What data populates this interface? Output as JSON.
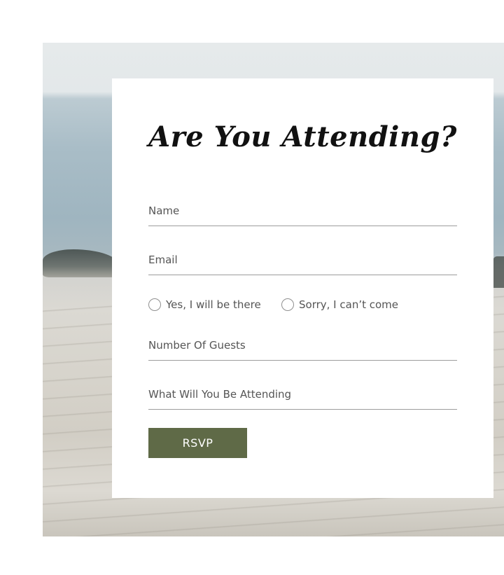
{
  "form": {
    "title": "Are You Attending?",
    "fields": {
      "name_placeholder": "Name",
      "email_placeholder": "Email",
      "guests_placeholder": "Number Of Guests",
      "attending_placeholder": "What Will You Be Attending"
    },
    "radio": {
      "yes_label": "Yes, I will be there",
      "no_label": "Sorry, I can’t come"
    },
    "submit_label": "RSVP"
  },
  "colors": {
    "button": "#5f6a47",
    "card": "#ffffff",
    "text": "#555555"
  }
}
